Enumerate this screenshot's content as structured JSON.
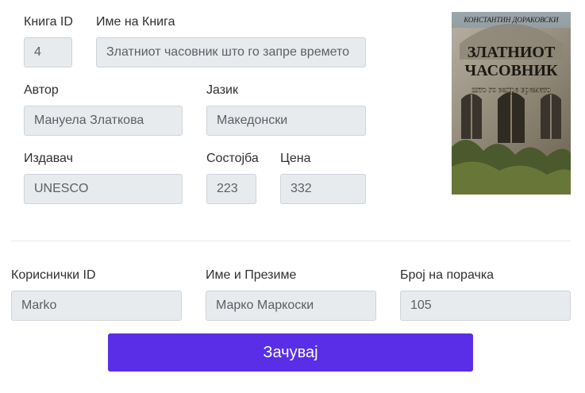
{
  "book": {
    "id_label": "Книга ID",
    "id_value": "4",
    "name_label": "Име на Книга",
    "name_value": "Златниот часовник што го запре времето",
    "author_label": "Автор",
    "author_value": "Мануела Златкова",
    "language_label": "Јазик",
    "language_value": "Македонски",
    "publisher_label": "Издавач",
    "publisher_value": "UNESCO",
    "stock_label": "Состојба",
    "stock_value": "223",
    "price_label": "Цена",
    "price_value": "332"
  },
  "cover": {
    "author_text": "КОНСТАНТИН ДОРАКОВСКИ",
    "title_line1": "ЗЛАТНИОТ",
    "title_line2": "ЧАСОВНИК",
    "subtitle": "што го запре времето"
  },
  "order": {
    "user_id_label": "Кориснички ID",
    "user_id_value": "Marko",
    "full_name_label": "Име и Презиме",
    "full_name_value": "Марко Маркоски",
    "order_number_label": "Број на порачка",
    "order_number_value": "105"
  },
  "actions": {
    "save_label": "Зачувај"
  },
  "colors": {
    "accent": "#5a2ee6",
    "input_bg": "#e8ebee"
  }
}
